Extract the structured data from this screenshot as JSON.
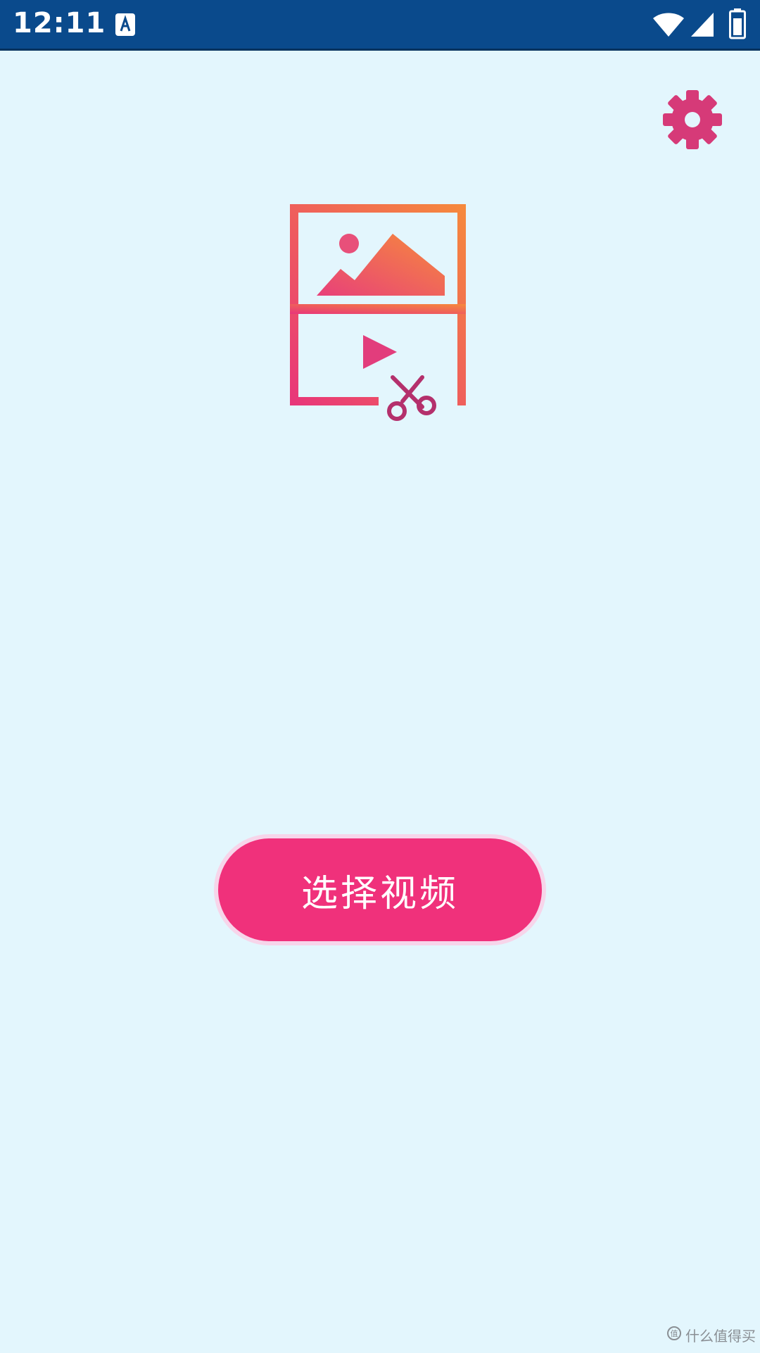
{
  "status_bar": {
    "time": "12:11",
    "notification_icon": "a-letter-icon",
    "wifi_icon": "wifi-icon",
    "signal_icon": "cell-signal-icon",
    "battery_icon": "battery-icon",
    "background_color": "#0a4a8c"
  },
  "toolbar": {
    "settings_icon": "gear-icon",
    "settings_color": "#d63a78"
  },
  "logo": {
    "icon": "image-video-cut-icon",
    "gradient_start": "#f68a3c",
    "gradient_end": "#e8357a"
  },
  "main": {
    "select_video_label": "选择视频",
    "button_color": "#f0317b"
  },
  "watermark": {
    "text": "什么值得买"
  }
}
